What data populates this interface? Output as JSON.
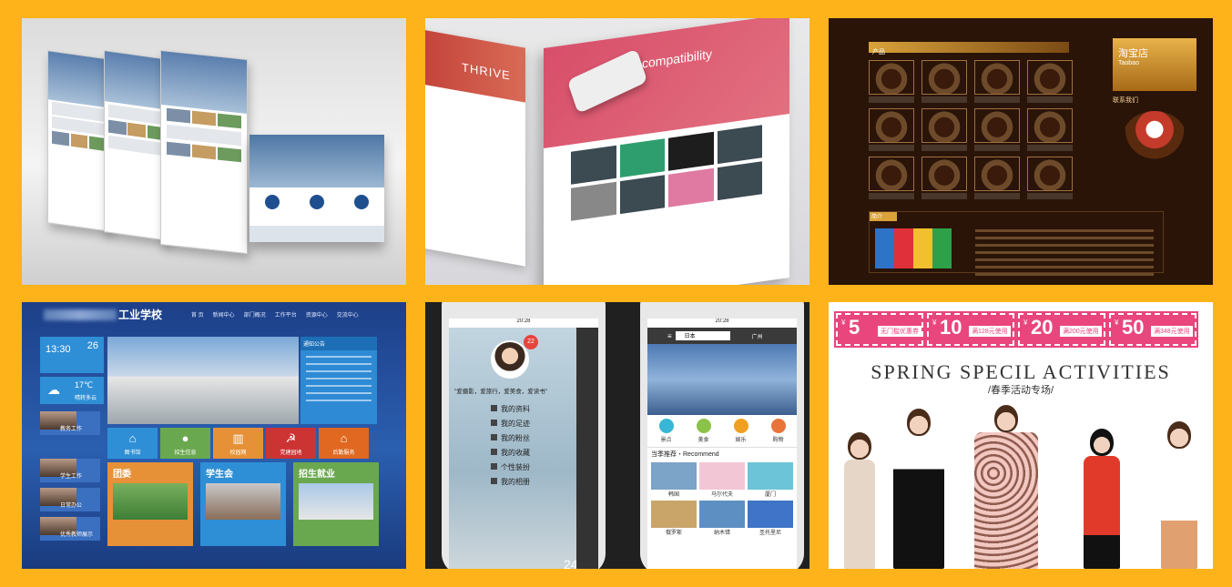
{
  "tile_school": {
    "title": "工业学校",
    "nav": [
      "首 页",
      "新闻中心",
      "部门概况",
      "工作平台",
      "资源中心",
      "交流中心"
    ],
    "clock_time": "13:30",
    "clock_day": "26",
    "weather_temp": "17℃",
    "weather_cond": "晴转多云",
    "notice_title": "通知公告",
    "left_labels": [
      "教务工作",
      "学生工作",
      "日常办公",
      "优秀教师展示"
    ],
    "icon_labels": [
      "图书馆",
      "招生信息",
      "校园网",
      "党建园地",
      "后勤服务"
    ],
    "cards": [
      "团委",
      "学生会",
      "招生就业"
    ]
  },
  "tile_responsive": {
    "left_hero": "THRIVE",
    "main_hero": "compatibility"
  },
  "tile_cake": {
    "section_label": "产品",
    "shop_name": "淘宝店",
    "shop_name_en": "Taobao",
    "contact_title": "联系我们",
    "bottom_label": "简介"
  },
  "tile_app": {
    "status_time": "20:28",
    "badge": "22",
    "quote": "\"爱摄影，爱旅行，爱美食，爱读书\"",
    "menu": [
      "我的资料",
      "我的足迹",
      "我的粉丝",
      "我的收藏",
      "个性装扮",
      "我的相册"
    ],
    "temperature": "24°",
    "search_value": "日本",
    "city": "广州",
    "categories": [
      "景点",
      "美食",
      "娱乐",
      "购物"
    ],
    "recommend_title": "当季推荐・Recommend",
    "places": [
      "韩国",
      "马尔代夫",
      "厦门",
      "俄罗斯",
      "纳木错",
      "圣托里尼"
    ]
  },
  "tile_fashion": {
    "coupons": [
      {
        "value": "5",
        "tag": "无门槛优惠券"
      },
      {
        "value": "10",
        "tag": "满128元使用"
      },
      {
        "value": "20",
        "tag": "满200元使用"
      },
      {
        "value": "50",
        "tag": "满348元使用"
      }
    ],
    "title": "SPRING SPECIL ACTIVITIES",
    "subtitle": "/春季活动专场/"
  },
  "colors": {
    "background": "#FFB31A",
    "school_blue": "#2B5FB0",
    "fashion_pink": "#E8467C",
    "cake_brown": "#2A1408"
  }
}
